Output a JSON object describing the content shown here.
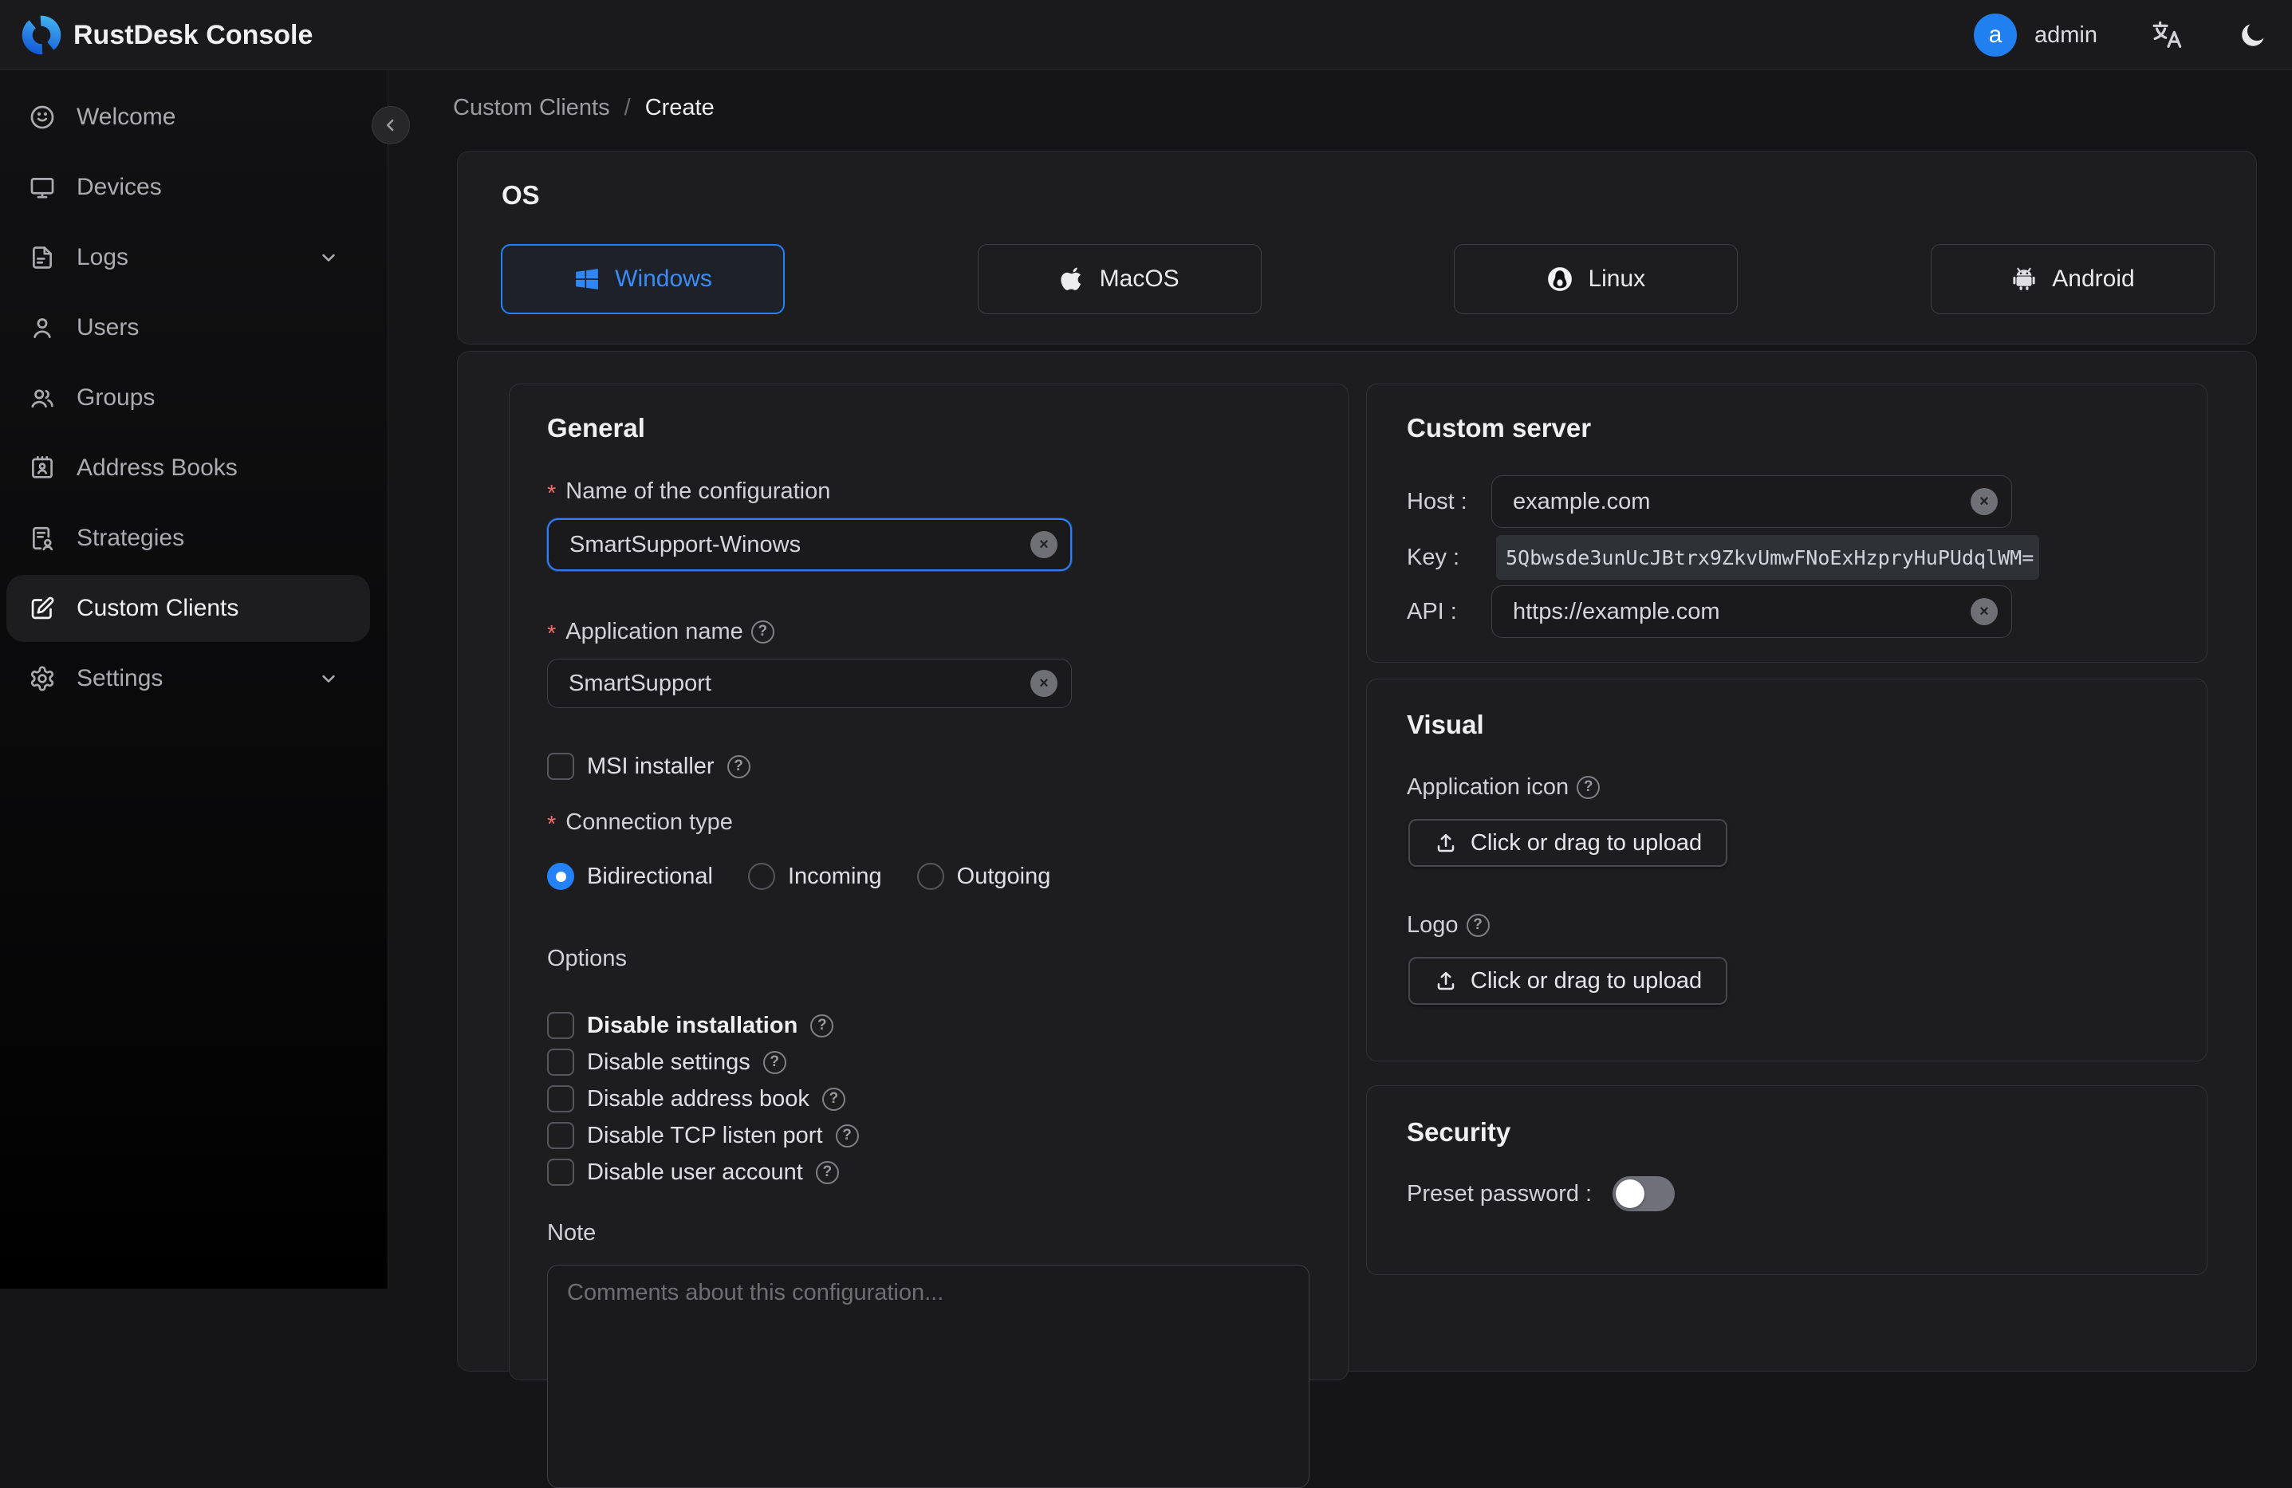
{
  "app": {
    "title": "RustDesk Console",
    "user": {
      "initial": "a",
      "name": "admin"
    }
  },
  "icons": {
    "question": "?",
    "close": "×",
    "asterisk": "*"
  },
  "colors": {
    "accent": "#2382f7",
    "danger": "#f56c6c",
    "avatar": "#2080f0",
    "card_bg": "#1d1d1f",
    "page_bg": "#151517"
  },
  "breadcrumb": {
    "parent": "Custom Clients",
    "separator": "/",
    "current": "Create"
  },
  "sidebar": {
    "items": [
      {
        "label": "Welcome"
      },
      {
        "label": "Devices"
      },
      {
        "label": "Logs",
        "expandable": true
      },
      {
        "label": "Users"
      },
      {
        "label": "Groups"
      },
      {
        "label": "Address Books"
      },
      {
        "label": "Strategies"
      },
      {
        "label": "Custom Clients",
        "selected": true
      },
      {
        "label": "Settings",
        "expandable": true
      }
    ]
  },
  "os": {
    "title": "OS",
    "options": [
      {
        "label": "Windows",
        "selected": true
      },
      {
        "label": "MacOS",
        "selected": false
      },
      {
        "label": "Linux",
        "selected": false
      },
      {
        "label": "Android",
        "selected": false
      }
    ]
  },
  "general": {
    "title": "General",
    "name_label": "Name of the configuration",
    "name_value": "SmartSupport-Winows",
    "app_name_label": "Application name",
    "app_name_value": "SmartSupport",
    "msi_label": "MSI installer",
    "msi_checked": false,
    "connection_type_label": "Connection type",
    "connection_options": [
      {
        "label": "Bidirectional",
        "selected": true
      },
      {
        "label": "Incoming",
        "selected": false
      },
      {
        "label": "Outgoing",
        "selected": false
      }
    ],
    "options_title": "Options",
    "options": [
      {
        "label": "Disable installation",
        "checked": false
      },
      {
        "label": "Disable settings",
        "checked": false
      },
      {
        "label": "Disable address book",
        "checked": false
      },
      {
        "label": "Disable TCP listen port",
        "checked": false
      },
      {
        "label": "Disable user account",
        "checked": false
      }
    ],
    "note_label": "Note",
    "note_placeholder": "Comments about this configuration..."
  },
  "custom_server": {
    "title": "Custom server",
    "host_label": "Host :",
    "host_value": "example.com",
    "key_label": "Key :",
    "key_value": "5Qbwsde3unUcJBtrx9ZkvUmwFNoExHzpryHuPUdqlWM=",
    "api_label": "API :",
    "api_value": "https://example.com"
  },
  "visual": {
    "title": "Visual",
    "app_icon_label": "Application icon",
    "logo_label": "Logo",
    "upload_label": "Click or drag to upload"
  },
  "security": {
    "title": "Security",
    "preset_password_label": "Preset password :",
    "preset_password_enabled": false
  }
}
